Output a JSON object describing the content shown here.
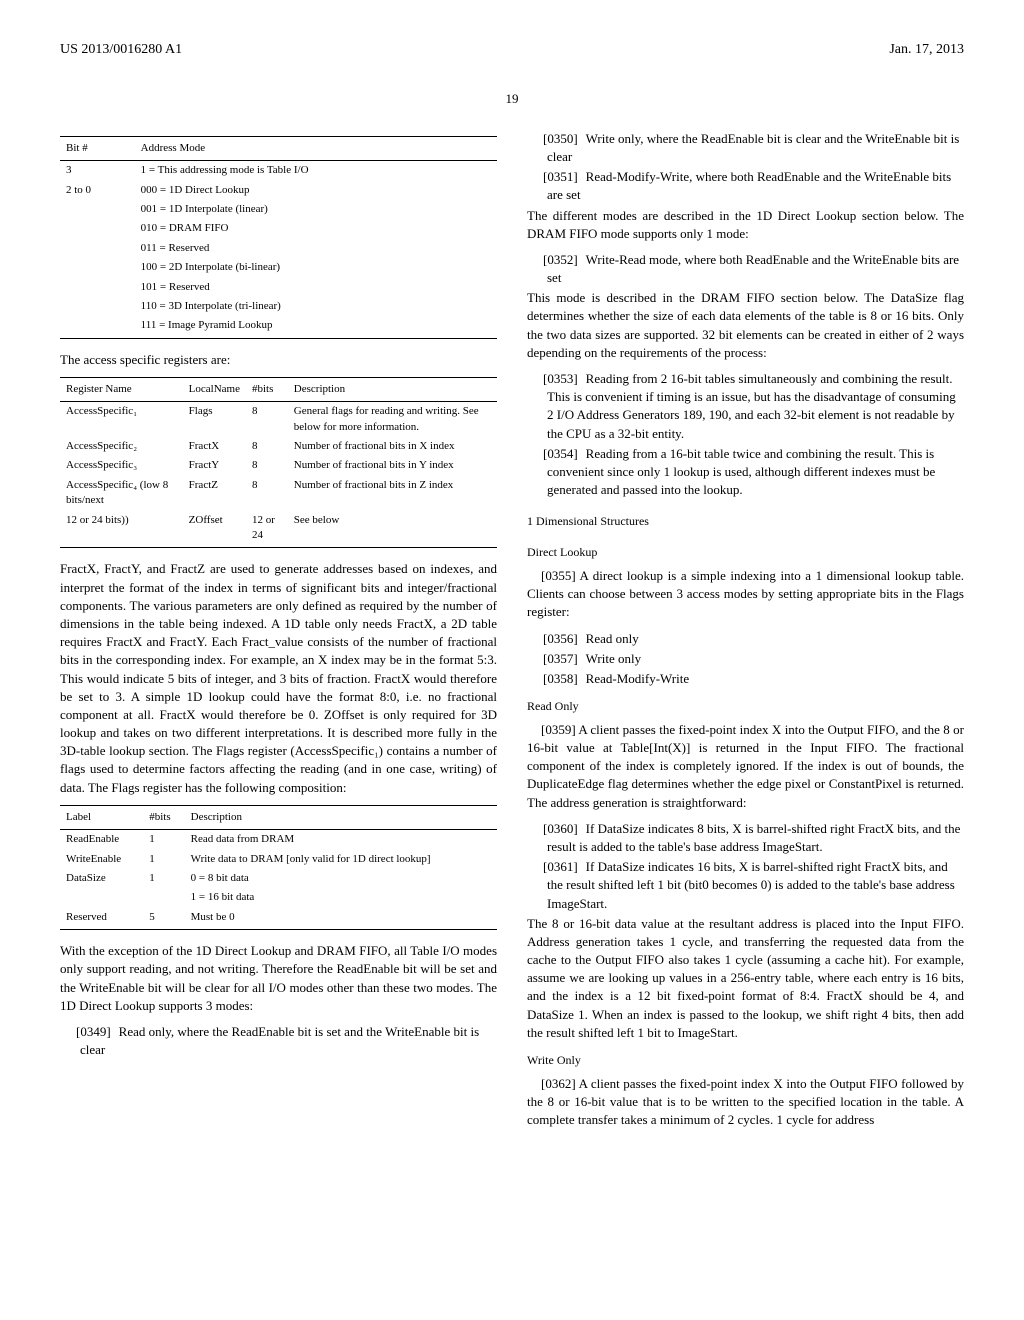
{
  "header": {
    "left": "US 2013/0016280 A1",
    "right": "Jan. 17, 2013"
  },
  "page_number": "19",
  "left_col": {
    "table1": {
      "headers": [
        "Bit #",
        "Address Mode"
      ],
      "rows": [
        [
          "3",
          "1 = This addressing mode is Table I/O"
        ],
        [
          "2 to 0",
          "000 = 1D Direct Lookup"
        ],
        [
          "",
          "001 = 1D Interpolate (linear)"
        ],
        [
          "",
          "010 = DRAM FIFO"
        ],
        [
          "",
          "011 = Reserved"
        ],
        [
          "",
          "100 = 2D Interpolate (bi-linear)"
        ],
        [
          "",
          "101 = Reserved"
        ],
        [
          "",
          "110 = 3D Interpolate (tri-linear)"
        ],
        [
          "",
          "111 = Image Pyramid Lookup"
        ]
      ]
    },
    "para1": "The access specific registers are:",
    "table2": {
      "headers": [
        "Register Name",
        "LocalName",
        "#bits",
        "Description"
      ],
      "rows": [
        [
          "AccessSpecific₁",
          "Flags",
          "8",
          "General flags for reading and writing. See below for more information."
        ],
        [
          "AccessSpecific₂",
          "FractX",
          "8",
          "Number of fractional bits in X index"
        ],
        [
          "AccessSpecific₃",
          "FractY",
          "8",
          "Number of fractional bits in Y index"
        ],
        [
          "AccessSpecific₄ (low 8 bits/next",
          "FractZ",
          "8",
          "Number of fractional bits in Z index"
        ],
        [
          "12 or 24 bits))",
          "ZOffset",
          "12 or 24",
          "See below"
        ]
      ]
    },
    "para2": "FractX, FractY, and FractZ are used to generate addresses based on indexes, and interpret the format of the index in terms of significant bits and integer/fractional components. The various parameters are only defined as required by the number of dimensions in the table being indexed. A 1D table only needs FractX, a 2D table requires FractX and FractY. Each Fract_value consists of the number of fractional bits in the corresponding index. For example, an X index may be in the format 5:3. This would indicate 5 bits of integer, and 3 bits of fraction. FractX would therefore be set to 3. A simple 1D lookup could have the format 8:0, i.e. no fractional component at all. FractX would therefore be 0. ZOffset is only required for 3D lookup and takes on two different interpretations. It is described more fully in the 3D-table lookup section. The Flags register (AccessSpecific₁) contains a number of flags used to determine factors affecting the reading (and in one case, writing) of data. The Flags register has the following composition:",
    "table3": {
      "headers": [
        "Label",
        "#bits",
        "Description"
      ],
      "rows": [
        [
          "ReadEnable",
          "1",
          "Read data from DRAM"
        ],
        [
          "WriteEnable",
          "1",
          "Write data to DRAM [only valid for 1D direct lookup]"
        ],
        [
          "DataSize",
          "1",
          "0 = 8 bit data"
        ],
        [
          "",
          "",
          "1 = 16 bit data"
        ],
        [
          "Reserved",
          "5",
          "Must be 0"
        ]
      ]
    },
    "para3": "With the exception of the 1D Direct Lookup and DRAM FIFO, all Table I/O modes only support reading, and not writing. Therefore the ReadEnable bit will be set and the WriteEnable bit will be clear for all I/O modes other than these two modes. The 1D Direct Lookup supports 3 modes:",
    "item0349": {
      "num": "[0349]",
      "text": "Read only, where the ReadEnable bit is set and the WriteEnable bit is clear"
    }
  },
  "right_col": {
    "item0350": {
      "num": "[0350]",
      "text": "Write only, where the ReadEnable bit is clear and the WriteEnable bit is clear"
    },
    "item0351": {
      "num": "[0351]",
      "text": "Read-Modify-Write, where both ReadEnable and the WriteEnable bits are set"
    },
    "para1": "The different modes are described in the 1D Direct Lookup section below. The DRAM FIFO mode supports only 1 mode:",
    "item0352": {
      "num": "[0352]",
      "text": "Write-Read mode, where both ReadEnable and the WriteEnable bits are set"
    },
    "para2": "This mode is described in the DRAM FIFO section below. The DataSize flag determines whether the size of each data elements of the table is 8 or 16 bits. Only the two data sizes are supported. 32 bit elements can be created in either of 2 ways depending on the requirements of the process:",
    "item0353": {
      "num": "[0353]",
      "text": "Reading from 2 16-bit tables simultaneously and combining the result. This is convenient if timing is an issue, but has the disadvantage of consuming 2 I/O Address Generators 189, 190, and each 32-bit element is not readable by the CPU as a 32-bit entity."
    },
    "item0354": {
      "num": "[0354]",
      "text": "Reading from a 16-bit table twice and combining the result. This is convenient since only 1 lookup is used, although different indexes must be generated and passed into the lookup."
    },
    "heading1": "1 Dimensional Structures",
    "heading2": "Direct Lookup",
    "item0355": {
      "num": "[0355]",
      "text": "A direct lookup is a simple indexing into a 1 dimensional lookup table. Clients can choose between 3 access modes by setting appropriate bits in the Flags register:"
    },
    "item0356": {
      "num": "[0356]",
      "text": "Read only"
    },
    "item0357": {
      "num": "[0357]",
      "text": "Write only"
    },
    "item0358": {
      "num": "[0358]",
      "text": "Read-Modify-Write"
    },
    "heading3": "Read Only",
    "item0359": {
      "num": "[0359]",
      "text": "A client passes the fixed-point index X into the Output FIFO, and the 8 or 16-bit value at Table[Int(X)] is returned in the Input FIFO. The fractional component of the index is completely ignored. If the index is out of bounds, the DuplicateEdge flag determines whether the edge pixel or ConstantPixel is returned. The address generation is straightforward:"
    },
    "item0360": {
      "num": "[0360]",
      "text": "If DataSize indicates 8 bits, X is barrel-shifted right FractX bits, and the result is added to the table's base address ImageStart."
    },
    "item0361": {
      "num": "[0361]",
      "text": "If DataSize indicates 16 bits, X is barrel-shifted right FractX bits, and the result shifted left 1 bit (bit0 becomes 0) is added to the table's base address ImageStart."
    },
    "para3": "The 8 or 16-bit data value at the resultant address is placed into the Input FIFO. Address generation takes 1 cycle, and transferring the requested data from the cache to the Output FIFO also takes 1 cycle (assuming a cache hit). For example, assume we are looking up values in a 256-entry table, where each entry is 16 bits, and the index is a 12 bit fixed-point format of 8:4. FractX should be 4, and DataSize 1. When an index is passed to the lookup, we shift right 4 bits, then add the result shifted left 1 bit to ImageStart.",
    "heading4": "Write Only",
    "item0362": {
      "num": "[0362]",
      "text": "A client passes the fixed-point index X into the Output FIFO followed by the 8 or 16-bit value that is to be written to the specified location in the table. A complete transfer takes a minimum of 2 cycles. 1 cycle for address"
    }
  }
}
